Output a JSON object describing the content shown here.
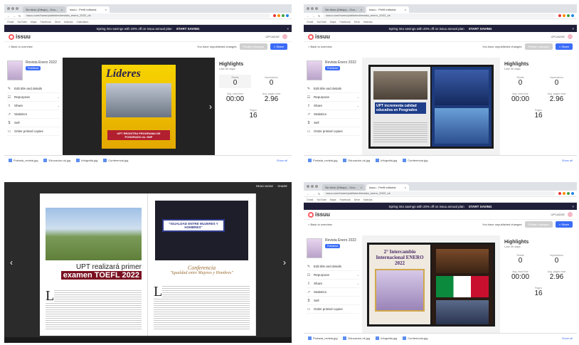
{
  "browser": {
    "tabs": [
      "Sin título (Dibujo) - Goo...",
      "Issuu - Perfil editorial"
    ],
    "url": "issuu.com/home/published/revista_enero_2022_ok",
    "bookmarks": [
      "Gmail",
      "YouTube",
      "Maps",
      "Facebook",
      "Drive",
      "Noticias",
      "Calendario"
    ]
  },
  "promo": {
    "text": "Spring into savings with 20% off on issuu annual plan",
    "cta": "START SAVING"
  },
  "issuu": {
    "logo": "issuu",
    "user": "UPCADDE",
    "back": "< Back to overview",
    "unpublished": "You have unpublished changes",
    "publish_btn": "Publish changes",
    "share_btn": "< Share"
  },
  "publication": {
    "title": "Revista Enero 2022",
    "tag": "Published"
  },
  "sidebar": [
    {
      "icon": "✎",
      "label": "Edit title and details",
      "chev": ""
    },
    {
      "icon": "☷",
      "label": "Repurpose",
      "chev": "⌄"
    },
    {
      "icon": "⇪",
      "label": "Share",
      "chev": "⌄"
    },
    {
      "icon": "↗",
      "label": "Statistics",
      "chev": ""
    },
    {
      "icon": "$",
      "label": "Sell",
      "chev": ""
    },
    {
      "icon": "▭",
      "label": "Order printed copies",
      "chev": ""
    }
  ],
  "highlights": {
    "title": "Highlights",
    "sub": "Last 30 days",
    "reads_label": "Reads",
    "reads": "0",
    "impressions_label": "Impressions",
    "impressions": "0",
    "avg_label": "Avg. read time",
    "avg": "00:00",
    "avgpages_label": "Avg. pages read",
    "avgpages": "2.96",
    "pages_label": "Pages",
    "pages": "16"
  },
  "cover": {
    "title": "Líderes",
    "caption": "UPT REGISTRA PROGRAMA DE POSGRADO AL SNP"
  },
  "spread2": {
    "headline": "UPT incrementa calidad educativa en Posgrados"
  },
  "full": {
    "header_left": "READ MODE",
    "header_right": "SHARE",
    "headline1": "UPT realizará primer",
    "headline2": "examen TOEFL 2022",
    "banner": "\"IGUALDAD ENTRE MUJERES Y HOMBRES\"",
    "conf_title": "Conferencia",
    "conf_sub": "\"Igualdad entre Mujeres y Hombres\"",
    "dropcap1": "L",
    "dropcap2": "L"
  },
  "spread4": {
    "title": "2° Intercambio Internacional ENERO 2022"
  },
  "downloads": [
    "Portada_revista.jpg",
    "Educacion-ok.jpg",
    "Infografia.jpg",
    "Conferencia.jpg"
  ],
  "show_all": "Show all"
}
